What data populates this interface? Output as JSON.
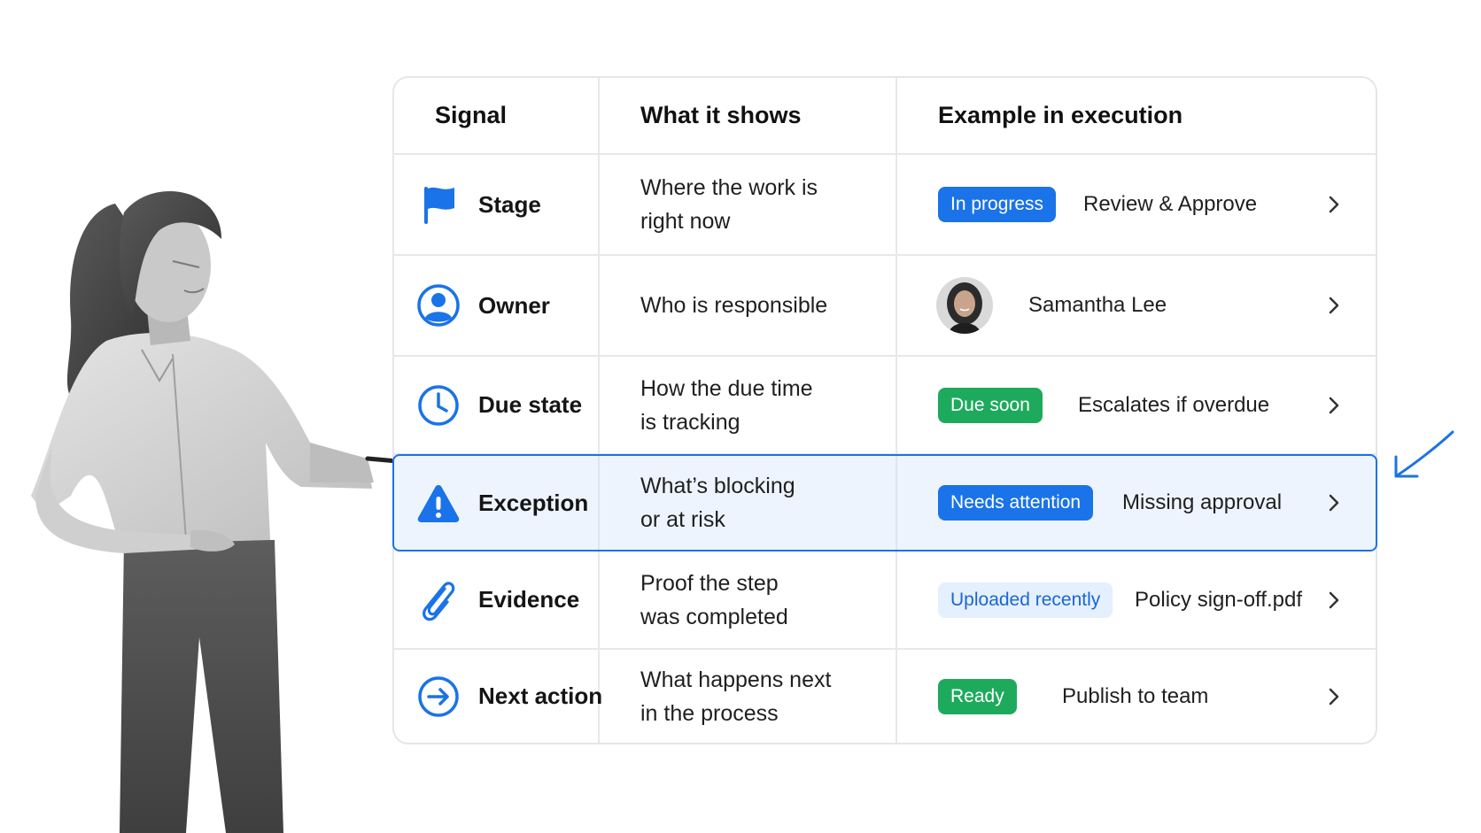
{
  "table": {
    "headers": {
      "signal": "Signal",
      "shows": "What it shows",
      "example": "Example in execution"
    },
    "rows": [
      {
        "signal": "Stage",
        "icon": "flag-icon",
        "shows": "Where the work is\nright now",
        "badge": "In progress",
        "badge_style": "blue",
        "example": "Review & Approve"
      },
      {
        "signal": "Owner",
        "icon": "user-icon",
        "shows": "Who is responsible",
        "badge": "",
        "example": "Samantha Lee"
      },
      {
        "signal": "Due state",
        "icon": "clock-icon",
        "shows": "How the due time\nis tracking",
        "badge": "Due soon",
        "badge_style": "green",
        "example": "Escalates if overdue"
      },
      {
        "signal": "Exception",
        "icon": "warning-icon",
        "shows": "What’s blocking\nor at risk",
        "badge": "Needs attention",
        "badge_style": "blue",
        "example": "Missing approval",
        "highlighted": true
      },
      {
        "signal": "Evidence",
        "icon": "paperclip-icon",
        "shows": "Proof the step\nwas completed",
        "badge": "Uploaded recently",
        "badge_style": "light",
        "example": "Policy sign-off.pdf"
      },
      {
        "signal": "Next action",
        "icon": "arrow-right-circle-icon",
        "shows": "What happens next\nin the process",
        "badge": "Ready",
        "badge_style": "green",
        "example": "Publish to team"
      }
    ]
  },
  "colors": {
    "accent": "#1a73e8",
    "success": "#1eaa5c",
    "badge_light_bg": "#e5f0fe",
    "highlight_bg": "#eef4fe",
    "border": "#e3e6ea"
  }
}
